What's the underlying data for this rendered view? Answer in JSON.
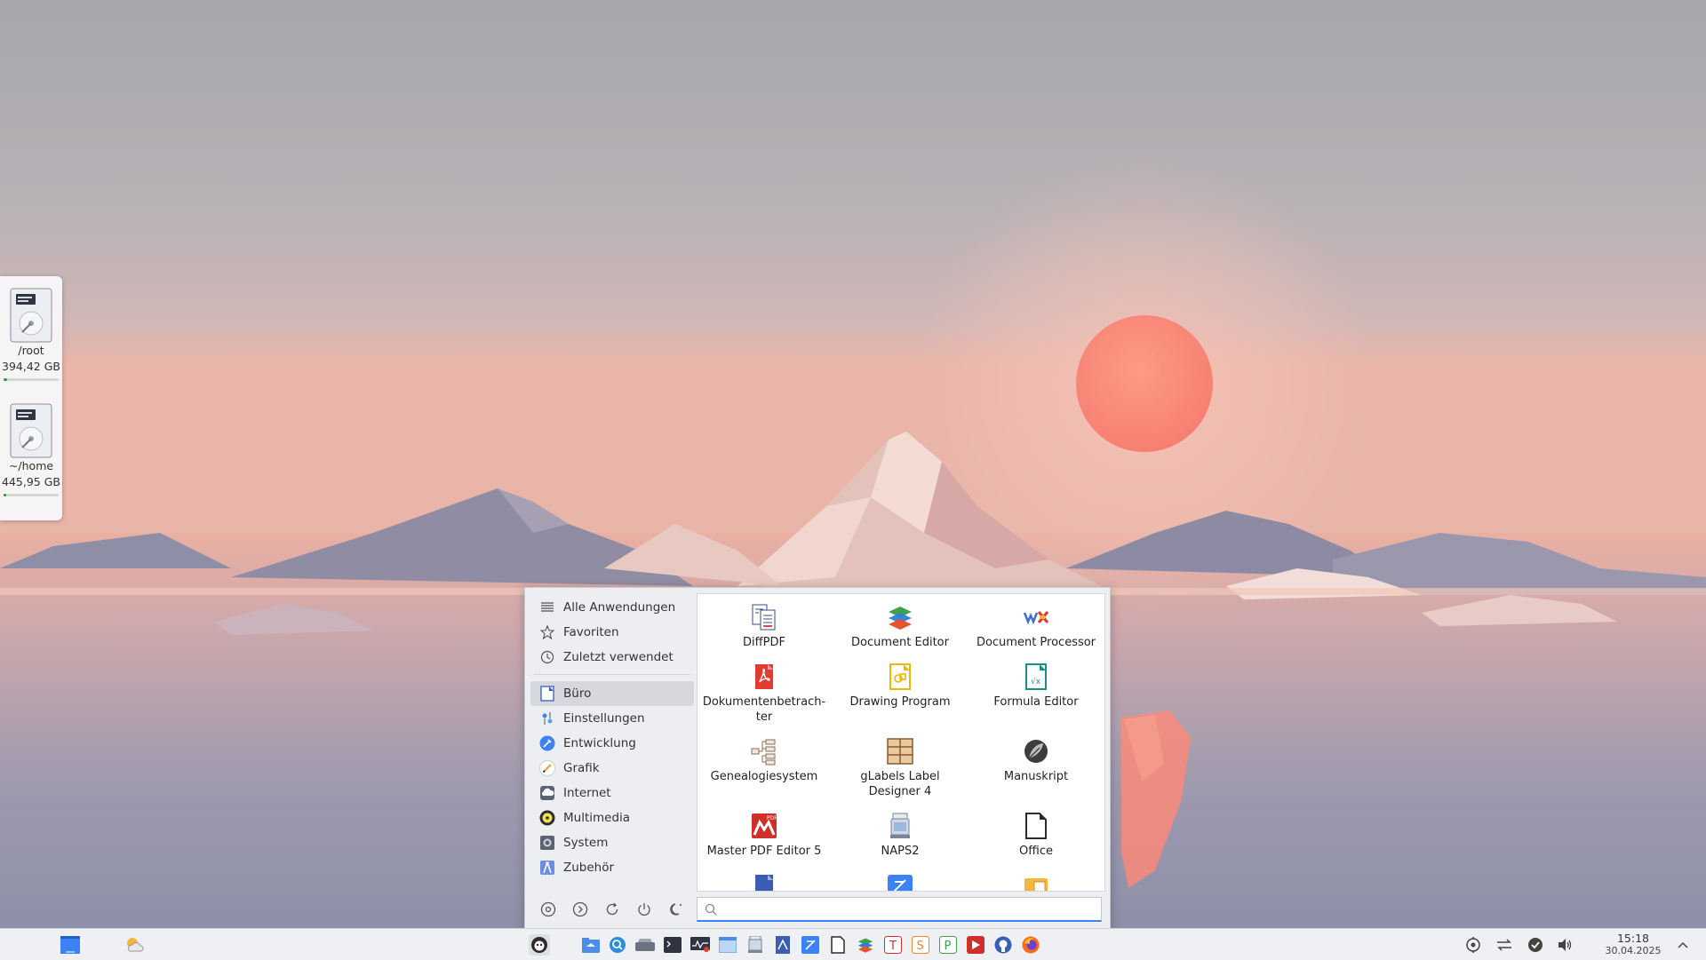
{
  "desktop": {
    "disks": [
      {
        "label": "/root",
        "size": "394,42 GB",
        "used_fraction": 0.06
      },
      {
        "label": "~/home",
        "size": "445,95 GB",
        "used_fraction": 0.05
      }
    ]
  },
  "start_menu": {
    "categories_top": [
      {
        "label": "Alle Anwendungen",
        "icon": "list-icon"
      },
      {
        "label": "Favoriten",
        "icon": "star-icon"
      },
      {
        "label": "Zuletzt verwendet",
        "icon": "history-icon"
      }
    ],
    "categories": [
      {
        "label": "Büro",
        "icon": "office-icon",
        "active": true
      },
      {
        "label": "Einstellungen",
        "icon": "settings-icon"
      },
      {
        "label": "Entwicklung",
        "icon": "development-icon"
      },
      {
        "label": "Grafik",
        "icon": "graphics-icon"
      },
      {
        "label": "Internet",
        "icon": "internet-icon"
      },
      {
        "label": "Multimedia",
        "icon": "multimedia-icon"
      },
      {
        "label": "System",
        "icon": "system-icon"
      },
      {
        "label": "Zubehör",
        "icon": "accessories-icon"
      }
    ],
    "apps": [
      {
        "label": "DiffPDF",
        "icon": "diffpdf-icon"
      },
      {
        "label": "Document Editor",
        "icon": "document-editor-icon"
      },
      {
        "label": "Document Processor",
        "icon": "wps-icon"
      },
      {
        "label": "Dokumentenbetrach-ter",
        "icon": "pdf-viewer-icon"
      },
      {
        "label": "Drawing Program",
        "icon": "drawing-icon"
      },
      {
        "label": "Formula Editor",
        "icon": "formula-icon"
      },
      {
        "label": "Genealogiesystem",
        "icon": "genealogy-icon"
      },
      {
        "label": "gLabels Label Designer 4",
        "icon": "glabels-icon"
      },
      {
        "label": "Manuskript",
        "icon": "manuskript-icon"
      },
      {
        "label": "Master PDF Editor 5",
        "icon": "master-pdf-icon"
      },
      {
        "label": "NAPS2",
        "icon": "scanner-icon"
      },
      {
        "label": "Office",
        "icon": "office-doc-icon"
      }
    ],
    "search": {
      "value": "",
      "placeholder": ""
    }
  },
  "taskbar": {
    "clock": {
      "time": "15:18",
      "date": "30.04.2025"
    }
  },
  "colors": {
    "accent": "#3b82f6",
    "sun": "#f98a7a",
    "taskbar_bg": "#eef0f3",
    "menu_bg": "#eceef2"
  }
}
